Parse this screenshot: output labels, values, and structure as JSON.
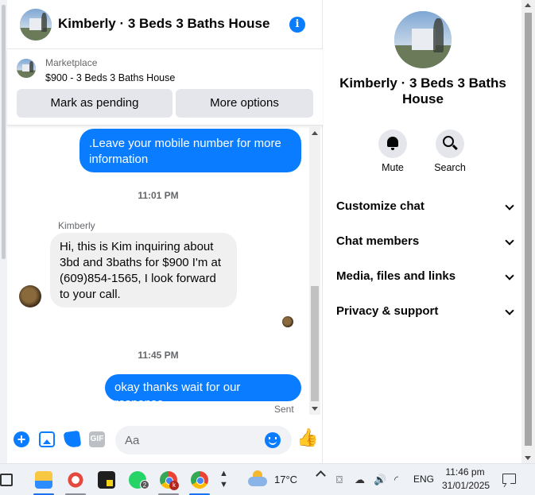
{
  "chat": {
    "title": "Kimberly · 3 Beds 3 Baths House",
    "marketplace_label": "Marketplace",
    "listing": "$900 - 3 Beds 3 Baths House",
    "mark_pending_label": "Mark as pending",
    "more_options_label": "More options",
    "messages": [
      {
        "from": "me",
        "text": ".Leave your mobile number for more information"
      },
      {
        "from": "system",
        "text": "11:01 PM"
      },
      {
        "from": "Kimberly",
        "sender_label": "Kimberly",
        "text": "Hi, this is Kim inquiring about 3bd and 3baths for $900 I'm at (609)854-1565, I look forward to your call."
      },
      {
        "from": "system",
        "text": "11:45 PM"
      },
      {
        "from": "me",
        "text": "okay thanks wait for our response",
        "status": "Sent"
      }
    ],
    "composer": {
      "placeholder": "Aa",
      "gif_label": "GIF"
    }
  },
  "details": {
    "title": "Kimberly · 3 Beds 3 Baths House",
    "mute_label": "Mute",
    "search_label": "Search",
    "sections": [
      "Customize chat",
      "Chat members",
      "Media, files and links",
      "Privacy & support"
    ]
  },
  "taskbar": {
    "whatsapp_badge": "2",
    "chrome_badge": "k",
    "temperature": "17°C",
    "language": "ENG",
    "time": "11:46 pm",
    "date": "31/01/2025"
  },
  "colors": {
    "accent": "#0a7cff",
    "bubble_incoming": "#f0f0f0",
    "button_gray": "#e4e6eb"
  },
  "icons": [
    "info-icon",
    "plus-icon",
    "photo-icon",
    "sticker-icon",
    "gif-icon",
    "emoji-icon",
    "like-icon",
    "bell-icon",
    "search-icon",
    "chevron-down-icon"
  ]
}
